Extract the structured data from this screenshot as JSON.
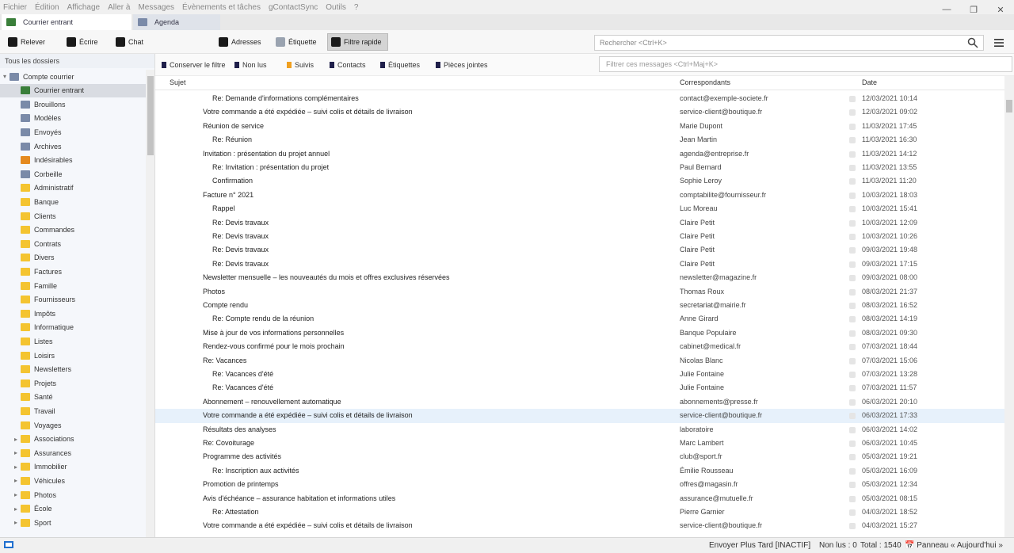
{
  "menubar": {
    "items": [
      "Fichier",
      "Édition",
      "Affichage",
      "Aller à",
      "Messages",
      "Évènements et tâches",
      "gContactSync",
      "Outils",
      "?"
    ]
  },
  "tabs": [
    {
      "label": "Courrier entrant",
      "active": true
    },
    {
      "label": "Agenda",
      "active": false
    }
  ],
  "toolbar": {
    "buttons": [
      "Relever",
      "Écrire",
      "Chat",
      "Adresses",
      "Étiquette",
      "Filtre rapide"
    ],
    "search_placeholder": "Rechercher <Ctrl+K>"
  },
  "quick_filter": {
    "items": [
      "Conserver le filtre",
      "Non lus",
      "Suivis",
      "Contacts",
      "Étiquettes",
      "Pièces jointes"
    ],
    "filter_placeholder": "Filtrer ces messages <Ctrl+Maj+K>"
  },
  "folder_pane": {
    "header": "Tous les dossiers",
    "folders": [
      {
        "name": "Compte courrier",
        "level": 0,
        "icon": "account",
        "twisty": "▾"
      },
      {
        "name": "Courrier entrant",
        "level": 1,
        "icon": "inbox",
        "selected": true
      },
      {
        "name": "Brouillons",
        "level": 1,
        "icon": "special"
      },
      {
        "name": "Modèles",
        "level": 1,
        "icon": "special"
      },
      {
        "name": "Envoyés",
        "level": 1,
        "icon": "special"
      },
      {
        "name": "Archives",
        "level": 1,
        "icon": "special"
      },
      {
        "name": "Indésirables",
        "level": 1,
        "icon": "sent"
      },
      {
        "name": "Corbeille",
        "level": 1,
        "icon": "special"
      },
      {
        "name": "Administratif",
        "level": 1,
        "icon": "folder"
      },
      {
        "name": "Banque",
        "level": 1,
        "icon": "folder"
      },
      {
        "name": "Clients",
        "level": 1,
        "icon": "folder"
      },
      {
        "name": "Commandes",
        "level": 1,
        "icon": "folder"
      },
      {
        "name": "Contrats",
        "level": 1,
        "icon": "folder"
      },
      {
        "name": "Divers",
        "level": 1,
        "icon": "folder"
      },
      {
        "name": "Factures",
        "level": 1,
        "icon": "folder"
      },
      {
        "name": "Famille",
        "level": 1,
        "icon": "folder"
      },
      {
        "name": "Fournisseurs",
        "level": 1,
        "icon": "folder"
      },
      {
        "name": "Impôts",
        "level": 1,
        "icon": "folder"
      },
      {
        "name": "Informatique",
        "level": 1,
        "icon": "folder"
      },
      {
        "name": "Listes",
        "level": 1,
        "icon": "folder"
      },
      {
        "name": "Loisirs",
        "level": 1,
        "icon": "folder"
      },
      {
        "name": "Newsletters",
        "level": 1,
        "icon": "folder"
      },
      {
        "name": "Projets",
        "level": 1,
        "icon": "folder"
      },
      {
        "name": "Santé",
        "level": 1,
        "icon": "folder"
      },
      {
        "name": "Travail",
        "level": 1,
        "icon": "folder"
      },
      {
        "name": "Voyages",
        "level": 1,
        "icon": "folder"
      },
      {
        "name": "Associations",
        "level": 1,
        "icon": "folder",
        "twisty": "▸"
      },
      {
        "name": "Assurances",
        "level": 1,
        "icon": "folder",
        "twisty": "▸"
      },
      {
        "name": "Immobilier",
        "level": 1,
        "icon": "folder",
        "twisty": "▸"
      },
      {
        "name": "Véhicules",
        "level": 1,
        "icon": "folder",
        "twisty": "▸"
      },
      {
        "name": "Photos",
        "level": 1,
        "icon": "folder",
        "twisty": "▸"
      },
      {
        "name": "École",
        "level": 1,
        "icon": "folder",
        "twisty": "▸"
      },
      {
        "name": "Sport",
        "level": 1,
        "icon": "folder",
        "twisty": "▸"
      }
    ]
  },
  "thread_pane": {
    "columns": [
      "Sujet",
      "Correspondants",
      "Date"
    ],
    "rows": [
      {
        "indent": 1,
        "subject": "Re: Demande d'informations complémentaires",
        "from": "contact@exemple-societe.fr",
        "date": "12/03/2021 10:14"
      },
      {
        "indent": 0,
        "subject": "Votre commande a été expédiée – suivi colis et détails de livraison",
        "from": "service-client@boutique.fr",
        "date": "12/03/2021 09:02"
      },
      {
        "indent": 0,
        "subject": "Réunion de service",
        "from": "Marie Dupont",
        "date": "11/03/2021 17:45"
      },
      {
        "indent": 1,
        "subject": "Re: Réunion",
        "from": "Jean Martin",
        "date": "11/03/2021 16:30"
      },
      {
        "indent": 0,
        "subject": "Invitation : présentation du projet annuel",
        "from": "agenda@entreprise.fr",
        "date": "11/03/2021 14:12"
      },
      {
        "indent": 1,
        "subject": "Re: Invitation : présentation du projet",
        "from": "Paul Bernard",
        "date": "11/03/2021 13:55"
      },
      {
        "indent": 1,
        "subject": "Confirmation",
        "from": "Sophie Leroy",
        "date": "11/03/2021 11:20"
      },
      {
        "indent": 0,
        "subject": "Facture n° 2021",
        "from": "comptabilite@fournisseur.fr",
        "date": "10/03/2021 18:03"
      },
      {
        "indent": 1,
        "subject": "Rappel",
        "from": "Luc Moreau",
        "date": "10/03/2021 15:41"
      },
      {
        "indent": 1,
        "subject": "Re: Devis travaux",
        "from": "Claire Petit",
        "date": "10/03/2021 12:09"
      },
      {
        "indent": 1,
        "subject": "Re: Devis travaux",
        "from": "Claire Petit",
        "date": "10/03/2021 10:26"
      },
      {
        "indent": 1,
        "subject": "Re: Devis travaux",
        "from": "Claire Petit",
        "date": "09/03/2021 19:48"
      },
      {
        "indent": 1,
        "subject": "Re: Devis travaux",
        "from": "Claire Petit",
        "date": "09/03/2021 17:15"
      },
      {
        "indent": 0,
        "subject": "Newsletter mensuelle – les nouveautés du mois et offres exclusives réservées",
        "from": "newsletter@magazine.fr",
        "date": "09/03/2021 08:00"
      },
      {
        "indent": 0,
        "subject": "Photos",
        "from": "Thomas Roux",
        "date": "08/03/2021 21:37"
      },
      {
        "indent": 0,
        "subject": "Compte rendu",
        "from": "secretariat@mairie.fr",
        "date": "08/03/2021 16:52"
      },
      {
        "indent": 1,
        "subject": "Re: Compte rendu de la réunion",
        "from": "Anne Girard",
        "date": "08/03/2021 14:19"
      },
      {
        "indent": 0,
        "subject": "Mise à jour de vos informations personnelles",
        "from": "Banque Populaire",
        "date": "08/03/2021 09:30"
      },
      {
        "indent": 0,
        "subject": "Rendez-vous confirmé pour le mois prochain",
        "from": "cabinet@medical.fr",
        "date": "07/03/2021 18:44"
      },
      {
        "indent": 0,
        "subject": "Re: Vacances",
        "from": "Nicolas Blanc",
        "date": "07/03/2021 15:06"
      },
      {
        "indent": 1,
        "subject": "Re: Vacances d'été",
        "from": "Julie Fontaine",
        "date": "07/03/2021 13:28"
      },
      {
        "indent": 1,
        "subject": "Re: Vacances d'été",
        "from": "Julie Fontaine",
        "date": "07/03/2021 11:57"
      },
      {
        "indent": 0,
        "subject": "Abonnement – renouvellement automatique",
        "from": "abonnements@presse.fr",
        "date": "06/03/2021 20:10"
      },
      {
        "indent": 0,
        "subject": "Votre commande a été expédiée – suivi colis et détails de livraison",
        "from": "service-client@boutique.fr",
        "date": "06/03/2021 17:33",
        "selected": true
      },
      {
        "indent": 0,
        "subject": "Résultats des analyses",
        "from": "laboratoire",
        "date": "06/03/2021 14:02"
      },
      {
        "indent": 0,
        "subject": "Re: Covoiturage",
        "from": "Marc Lambert",
        "date": "06/03/2021 10:45"
      },
      {
        "indent": 0,
        "subject": "Programme des activités",
        "from": "club@sport.fr",
        "date": "05/03/2021 19:21"
      },
      {
        "indent": 1,
        "subject": "Re: Inscription aux activités",
        "from": "Émilie Rousseau",
        "date": "05/03/2021 16:09"
      },
      {
        "indent": 0,
        "subject": "Promotion de printemps",
        "from": "offres@magasin.fr",
        "date": "05/03/2021 12:34"
      },
      {
        "indent": 0,
        "subject": "Avis d'échéance – assurance habitation et informations utiles",
        "from": "assurance@mutuelle.fr",
        "date": "05/03/2021 08:15"
      },
      {
        "indent": 1,
        "subject": "Re: Attestation",
        "from": "Pierre Garnier",
        "date": "04/03/2021 18:52"
      },
      {
        "indent": 0,
        "subject": "Votre commande a été expédiée – suivi colis et détails de livraison",
        "from": "service-client@boutique.fr",
        "date": "04/03/2021 15:27"
      }
    ]
  },
  "statusbar": {
    "send_later": "Envoyer Plus Tard [INACTIF]",
    "unread": "Non lus : 0",
    "total": "Total : 1540",
    "today_pane": "Panneau « Aujourd'hui »"
  },
  "colors": {
    "accent": "#1f6fcf",
    "selection_row": "#e7f1fb",
    "folder": "#f4c430"
  }
}
